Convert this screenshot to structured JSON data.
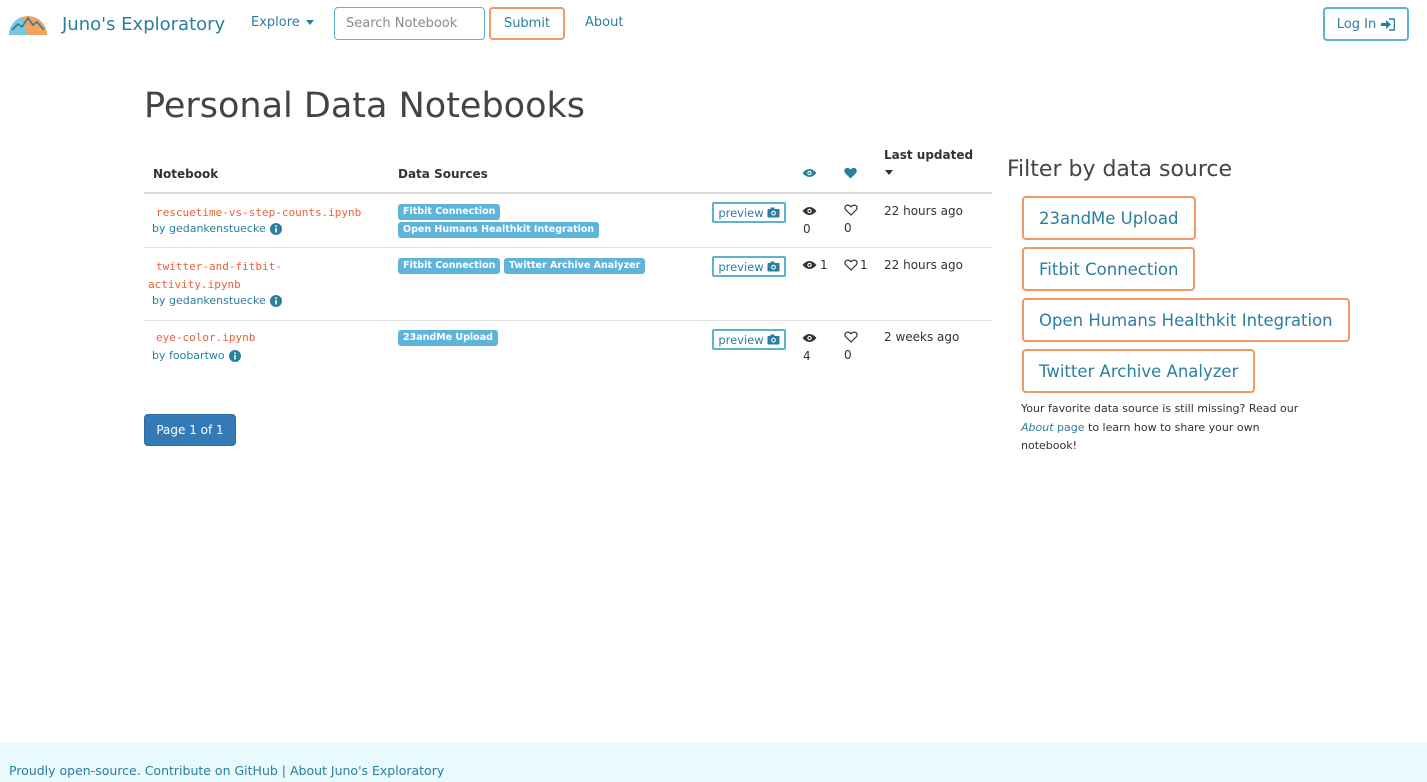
{
  "brand": {
    "name": "Juno's Exploratory"
  },
  "nav": {
    "explore_label": "Explore",
    "search_placeholder": "Search Notebook",
    "submit_label": "Submit",
    "about_label": "About",
    "login_label": "Log In"
  },
  "page": {
    "title": "Personal Data Notebooks"
  },
  "table": {
    "headers": {
      "notebook": "Notebook",
      "data_sources": "Data Sources",
      "views_icon": "eye-icon",
      "likes_icon": "heart-icon",
      "last_updated": "Last updated"
    },
    "preview_label": "preview",
    "rows": [
      {
        "name": "rescuetime-vs-step-counts.ipynb",
        "author": "by gedankenstuecke",
        "sources": [
          "Fitbit Connection",
          "Open Humans Healthkit Integration"
        ],
        "views": "0",
        "likes": "0",
        "updated": "22 hours ago"
      },
      {
        "name": "twitter-and-fitbit-activity.ipynb",
        "author": "by gedankenstuecke",
        "sources": [
          "Fitbit Connection",
          "Twitter Archive Analyzer"
        ],
        "views": "1",
        "likes": "1",
        "updated": "22 hours ago"
      },
      {
        "name": "eye-color.ipynb",
        "author": "by foobartwo",
        "sources": [
          "23andMe Upload"
        ],
        "views": "4",
        "likes": "0",
        "updated": "2 weeks ago"
      }
    ]
  },
  "pagination": {
    "label": "Page 1 of 1"
  },
  "filter": {
    "title": "Filter by data source",
    "sources": [
      "23andMe Upload",
      "Fitbit Connection",
      "Open Humans Healthkit Integration",
      "Twitter Archive Analyzer"
    ],
    "note_before": "Your favorite data source is still missing? Read our ",
    "note_link_italic": "About",
    "note_link_rest": " page",
    "note_after": " to learn how to share your own notebook!"
  },
  "footer": {
    "prefix": "Proudly open-source. ",
    "github_link": "Contribute on GitHub",
    "separator": " | ",
    "about_link": "About Juno's Exploratory"
  },
  "colors": {
    "accent": "#2a7f9e",
    "orange": "#f0986a",
    "notebook_name": "#e8613a",
    "badge": "#5fb4db",
    "page_button": "#337ab7",
    "footer_bg": "#e8fafb"
  }
}
